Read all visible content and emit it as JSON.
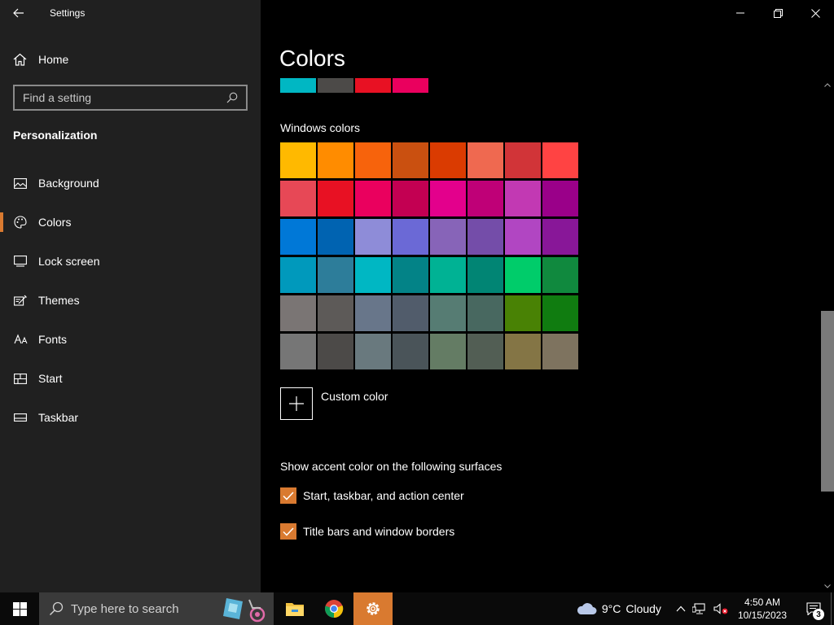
{
  "app": {
    "title": "Settings"
  },
  "sidebar": {
    "home_label": "Home",
    "search_placeholder": "Find a setting",
    "section": "Personalization",
    "items": [
      {
        "label": "Background",
        "icon": "picture-icon",
        "active": false
      },
      {
        "label": "Colors",
        "icon": "palette-icon",
        "active": true
      },
      {
        "label": "Lock screen",
        "icon": "lock-screen-icon",
        "active": false
      },
      {
        "label": "Themes",
        "icon": "themes-icon",
        "active": false
      },
      {
        "label": "Fonts",
        "icon": "fonts-icon",
        "active": false
      },
      {
        "label": "Start",
        "icon": "start-icon",
        "active": false
      },
      {
        "label": "Taskbar",
        "icon": "taskbar-icon",
        "active": false
      }
    ]
  },
  "main": {
    "title": "Colors",
    "recent_colors": [
      "#00b7c3",
      "#4c4a48",
      "#e81123",
      "#ea005e"
    ],
    "windows_colors_label": "Windows colors",
    "windows_colors": [
      "#ffb900",
      "#ff8c00",
      "#f7630c",
      "#ca5010",
      "#da3b01",
      "#ef6950",
      "#d13438",
      "#ff4343",
      "#e74856",
      "#e81123",
      "#ea005e",
      "#c30052",
      "#e3008c",
      "#bf0077",
      "#c239b3",
      "#9a0089",
      "#0078d7",
      "#0063b1",
      "#8e8cd8",
      "#6b69d6",
      "#8764b8",
      "#744da9",
      "#b146c2",
      "#881798",
      "#0099bc",
      "#2d7d9a",
      "#00b7c3",
      "#038387",
      "#00b294",
      "#018574",
      "#00cc6a",
      "#10893e",
      "#7a7574",
      "#5d5a58",
      "#68768a",
      "#515c6b",
      "#567c73",
      "#486860",
      "#498205",
      "#107c10",
      "#767676",
      "#4c4a48",
      "#69797e",
      "#4a5459",
      "#647c64",
      "#525e54",
      "#847545",
      "#7e735f"
    ],
    "custom_color_label": "Custom color",
    "accent_surfaces_label": "Show accent color on the following surfaces",
    "checkboxes": [
      {
        "label": "Start, taskbar, and action center",
        "checked": true
      },
      {
        "label": "Title bars and window borders",
        "checked": true
      }
    ],
    "accent_color": "#d97a30"
  },
  "taskbar": {
    "search_placeholder": "Type here to search",
    "apps": [
      "file-explorer-icon",
      "chrome-icon",
      "settings-icon"
    ],
    "weather_temp": "9°C",
    "weather_desc": "Cloudy",
    "time": "4:50 AM",
    "date": "10/15/2023",
    "notification_count": "3"
  }
}
